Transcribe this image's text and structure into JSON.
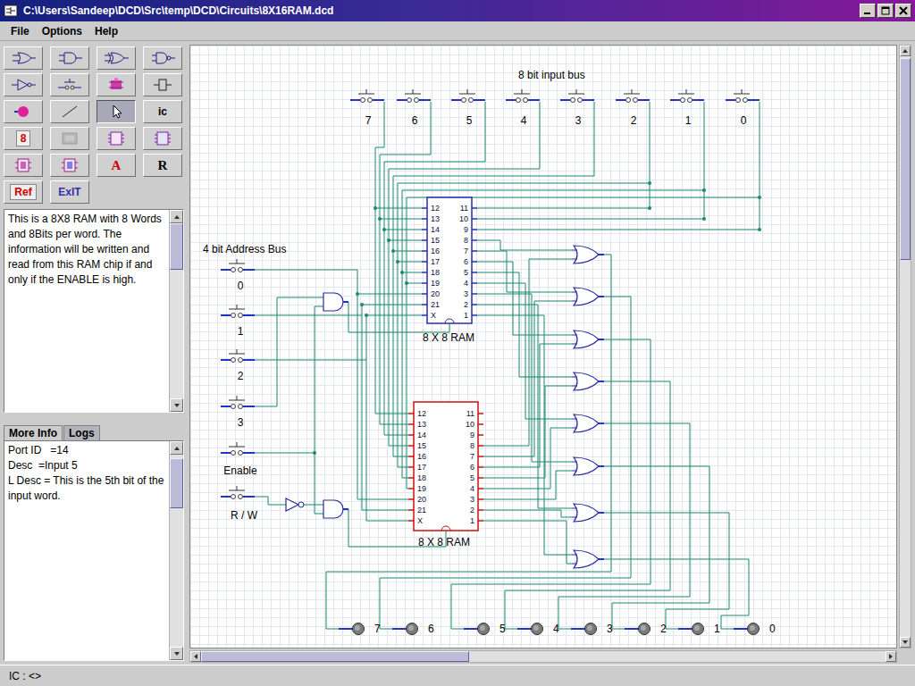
{
  "window": {
    "title": "C:\\Users\\Sandeep\\DCD\\Src\\temp\\DCD\\Circuits\\8X16RAM.dcd"
  },
  "menu": [
    {
      "label": "File"
    },
    {
      "label": "Options"
    },
    {
      "label": "Help"
    }
  ],
  "toolbar": [
    {
      "selected": false,
      "disabled": false
    },
    {
      "selected": false,
      "disabled": false
    },
    {
      "selected": false,
      "disabled": false
    },
    {
      "selected": false,
      "disabled": false
    },
    {
      "selected": false,
      "disabled": false
    },
    {
      "selected": false,
      "disabled": false
    },
    {
      "selected": false,
      "disabled": false
    },
    {
      "selected": false,
      "disabled": false
    },
    {
      "selected": false,
      "disabled": false
    },
    {
      "selected": false,
      "disabled": false
    },
    {
      "selected": true,
      "disabled": false
    },
    {
      "label": "ic",
      "color": "#000000",
      "selected": false,
      "disabled": false
    },
    {
      "label": "8",
      "color": "#cc0000",
      "selected": false,
      "disabled": false
    },
    {
      "selected": false,
      "disabled": true
    },
    {
      "selected": false,
      "disabled": false
    },
    {
      "selected": false,
      "disabled": false
    },
    {
      "selected": false,
      "disabled": false
    },
    {
      "selected": false,
      "disabled": false
    },
    {
      "label": "A",
      "color": "#cc0000",
      "selected": false,
      "disabled": false
    },
    {
      "label": "R",
      "color": "#000000",
      "selected": false,
      "disabled": false
    },
    {
      "label": "Ref",
      "color": "#cc0000",
      "selected": false,
      "disabled": false
    },
    {
      "label": "ExIT",
      "color": "#3333aa",
      "selected": false,
      "disabled": false
    }
  ],
  "description": "This is a 8X8 RAM with 8 Words and 8Bits per word. The information will be written and read from this RAM chip if and only if the ENABLE is high.",
  "info_tabs": [
    {
      "label": "More Info",
      "selected": true
    },
    {
      "label": "Logs",
      "selected": false
    }
  ],
  "info_lines": [
    "Port ID   =14",
    "Desc  =Input 5",
    "L Desc = This is the 5th bit of the input word."
  ],
  "circuit": {
    "input_bus": {
      "title": "8 bit input bus",
      "switches": [
        "7",
        "6",
        "5",
        "4",
        "3",
        "2",
        "1",
        "0"
      ]
    },
    "address_bus": {
      "title": "4 bit Address Bus",
      "switches": [
        "0",
        "1",
        "2",
        "3"
      ]
    },
    "controls": [
      "Enable",
      "R / W"
    ],
    "chips": [
      {
        "label": "8 X 8 RAM",
        "left_pins": [
          "12",
          "13",
          "14",
          "15",
          "16",
          "17",
          "18",
          "19",
          "20",
          "21",
          "X"
        ],
        "right_pins": [
          "11",
          "10",
          "9",
          "8",
          "7",
          "6",
          "5",
          "4",
          "3",
          "2",
          "1"
        ],
        "color": "#2b2bb0"
      },
      {
        "label": "8 X 8 RAM",
        "left_pins": [
          "12",
          "13",
          "14",
          "15",
          "16",
          "17",
          "18",
          "19",
          "20",
          "21",
          "X"
        ],
        "right_pins": [
          "11",
          "10",
          "9",
          "8",
          "7",
          "6",
          "5",
          "4",
          "3",
          "2",
          "1"
        ],
        "color": "#cc1010"
      }
    ],
    "outputs": [
      "7",
      "6",
      "5",
      "4",
      "3",
      "2",
      "1",
      "0"
    ]
  },
  "status_bar": "IC : <>"
}
